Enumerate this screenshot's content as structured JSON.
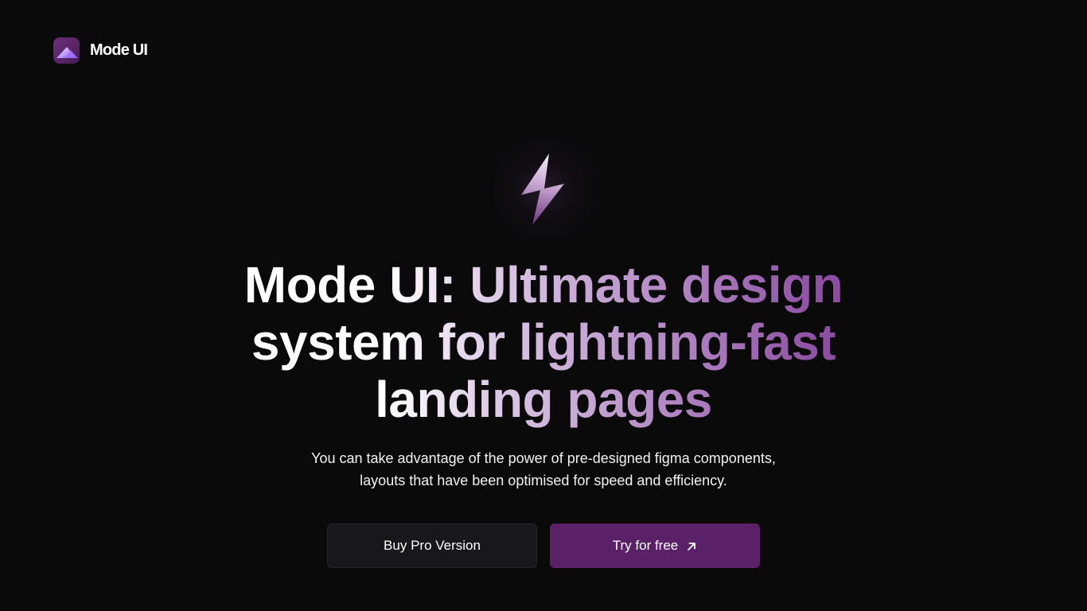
{
  "header": {
    "brand_name": "Mode UI",
    "logo_icon": "mode-ui-logo-icon"
  },
  "hero": {
    "icon": "lightning-bolt-icon",
    "headline_line1": "Mode UI: Ultimate design",
    "headline_line2": "system for lightning-fast",
    "headline_line3": "landing pages",
    "description_line1": "You can take advantage of the power of pre-designed figma components,",
    "description_line2": "layouts that have been optimised for speed and efficiency."
  },
  "actions": {
    "secondary_label": "Buy Pro Version",
    "primary_label": "Try for free",
    "primary_icon": "arrow-up-right-icon"
  },
  "colors": {
    "background": "#0a0a0b",
    "accent": "#5b2168",
    "secondary_button": "#18181b",
    "headline_gradient_end": "#8e4fa3"
  }
}
